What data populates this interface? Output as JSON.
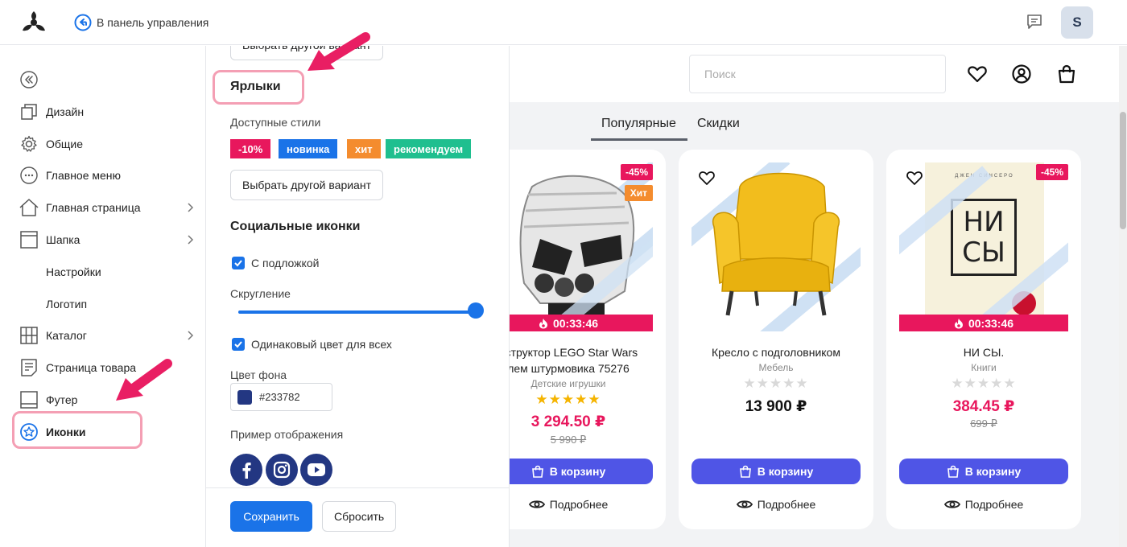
{
  "topbar": {
    "back_label": "В панель управления",
    "avatar_letter": "S"
  },
  "nav": {
    "items": [
      {
        "label": "Дизайн",
        "icon": "copy-icon"
      },
      {
        "label": "Общие",
        "icon": "gear-icon"
      },
      {
        "label": "Главное меню",
        "icon": "dots-circle-icon"
      },
      {
        "label": "Главная страница",
        "icon": "home-icon"
      },
      {
        "label": "Шапка",
        "icon": "header-icon"
      },
      {
        "label": "Настройки"
      },
      {
        "label": "Логотип"
      },
      {
        "label": "Каталог",
        "icon": "grid-icon"
      },
      {
        "label": "Страница товара",
        "icon": "document-icon"
      },
      {
        "label": "Футер",
        "icon": "footer-icon"
      },
      {
        "label": "Иконки",
        "icon": "star-circle-icon",
        "active": true
      }
    ]
  },
  "panel": {
    "choose_label": "Выбрать другой вариант",
    "labels_title": "Ярлыки",
    "available_styles": "Доступные стили",
    "badges": [
      {
        "text": "-10%",
        "color": "#e8175d"
      },
      {
        "text": "новинка",
        "color": "#1a73e8"
      },
      {
        "text": "хит",
        "color": "#f48c2e"
      },
      {
        "text": "рекомендуем",
        "color": "#1fbf8f"
      }
    ],
    "social_title": "Социальные иконки",
    "with_backing": "С подложкой",
    "rounding": "Скругление",
    "rounding_value": 1.0,
    "same_color": "Одинаковый цвет для всех",
    "bg_color_label": "Цвет фона",
    "bg_color_value": "#233782",
    "example_label": "Пример отображения",
    "social_icons": [
      "facebook-icon",
      "instagram-icon",
      "youtube-icon"
    ],
    "save": "Сохранить",
    "reset": "Сбросить"
  },
  "store": {
    "search_placeholder": "Поиск",
    "tabs": [
      "Популярные",
      "Скидки"
    ],
    "cart_label": "В корзину",
    "more_label": "Подробнее",
    "products": [
      {
        "name_line1": "нструктор LEGO Star Wars",
        "name_line2": "лем штурмовика 75276",
        "category": "Детские игрушки",
        "rating": 5,
        "price": "3 294.50 ₽",
        "old_price": "5 990 ₽",
        "discount": "-45%",
        "hit": "Хит",
        "timer": "00:33:46"
      },
      {
        "name_line1": "Кресло с подголовником",
        "name_line2": "",
        "category": "Мебель",
        "rating": 0,
        "price": "13 900 ₽",
        "old_price": "",
        "discount": "",
        "hit": "",
        "timer": ""
      },
      {
        "name_line1": "НИ СЫ.",
        "name_line2": "",
        "category": "Книги",
        "rating": 0,
        "price": "384.45 ₽",
        "old_price": "699 ₽",
        "discount": "-45%",
        "hit": "",
        "timer": "00:33:46",
        "book_title_1": "НИ",
        "book_title_2": "СЫ",
        "book_author": "ДЖЕН СИНСЕРО"
      }
    ]
  },
  "colors": {
    "accent": "#1a73e8",
    "sale": "#e8175d",
    "cart": "#4f55e6",
    "highlight": "#f49fb4",
    "arrow": "#e91e63"
  }
}
